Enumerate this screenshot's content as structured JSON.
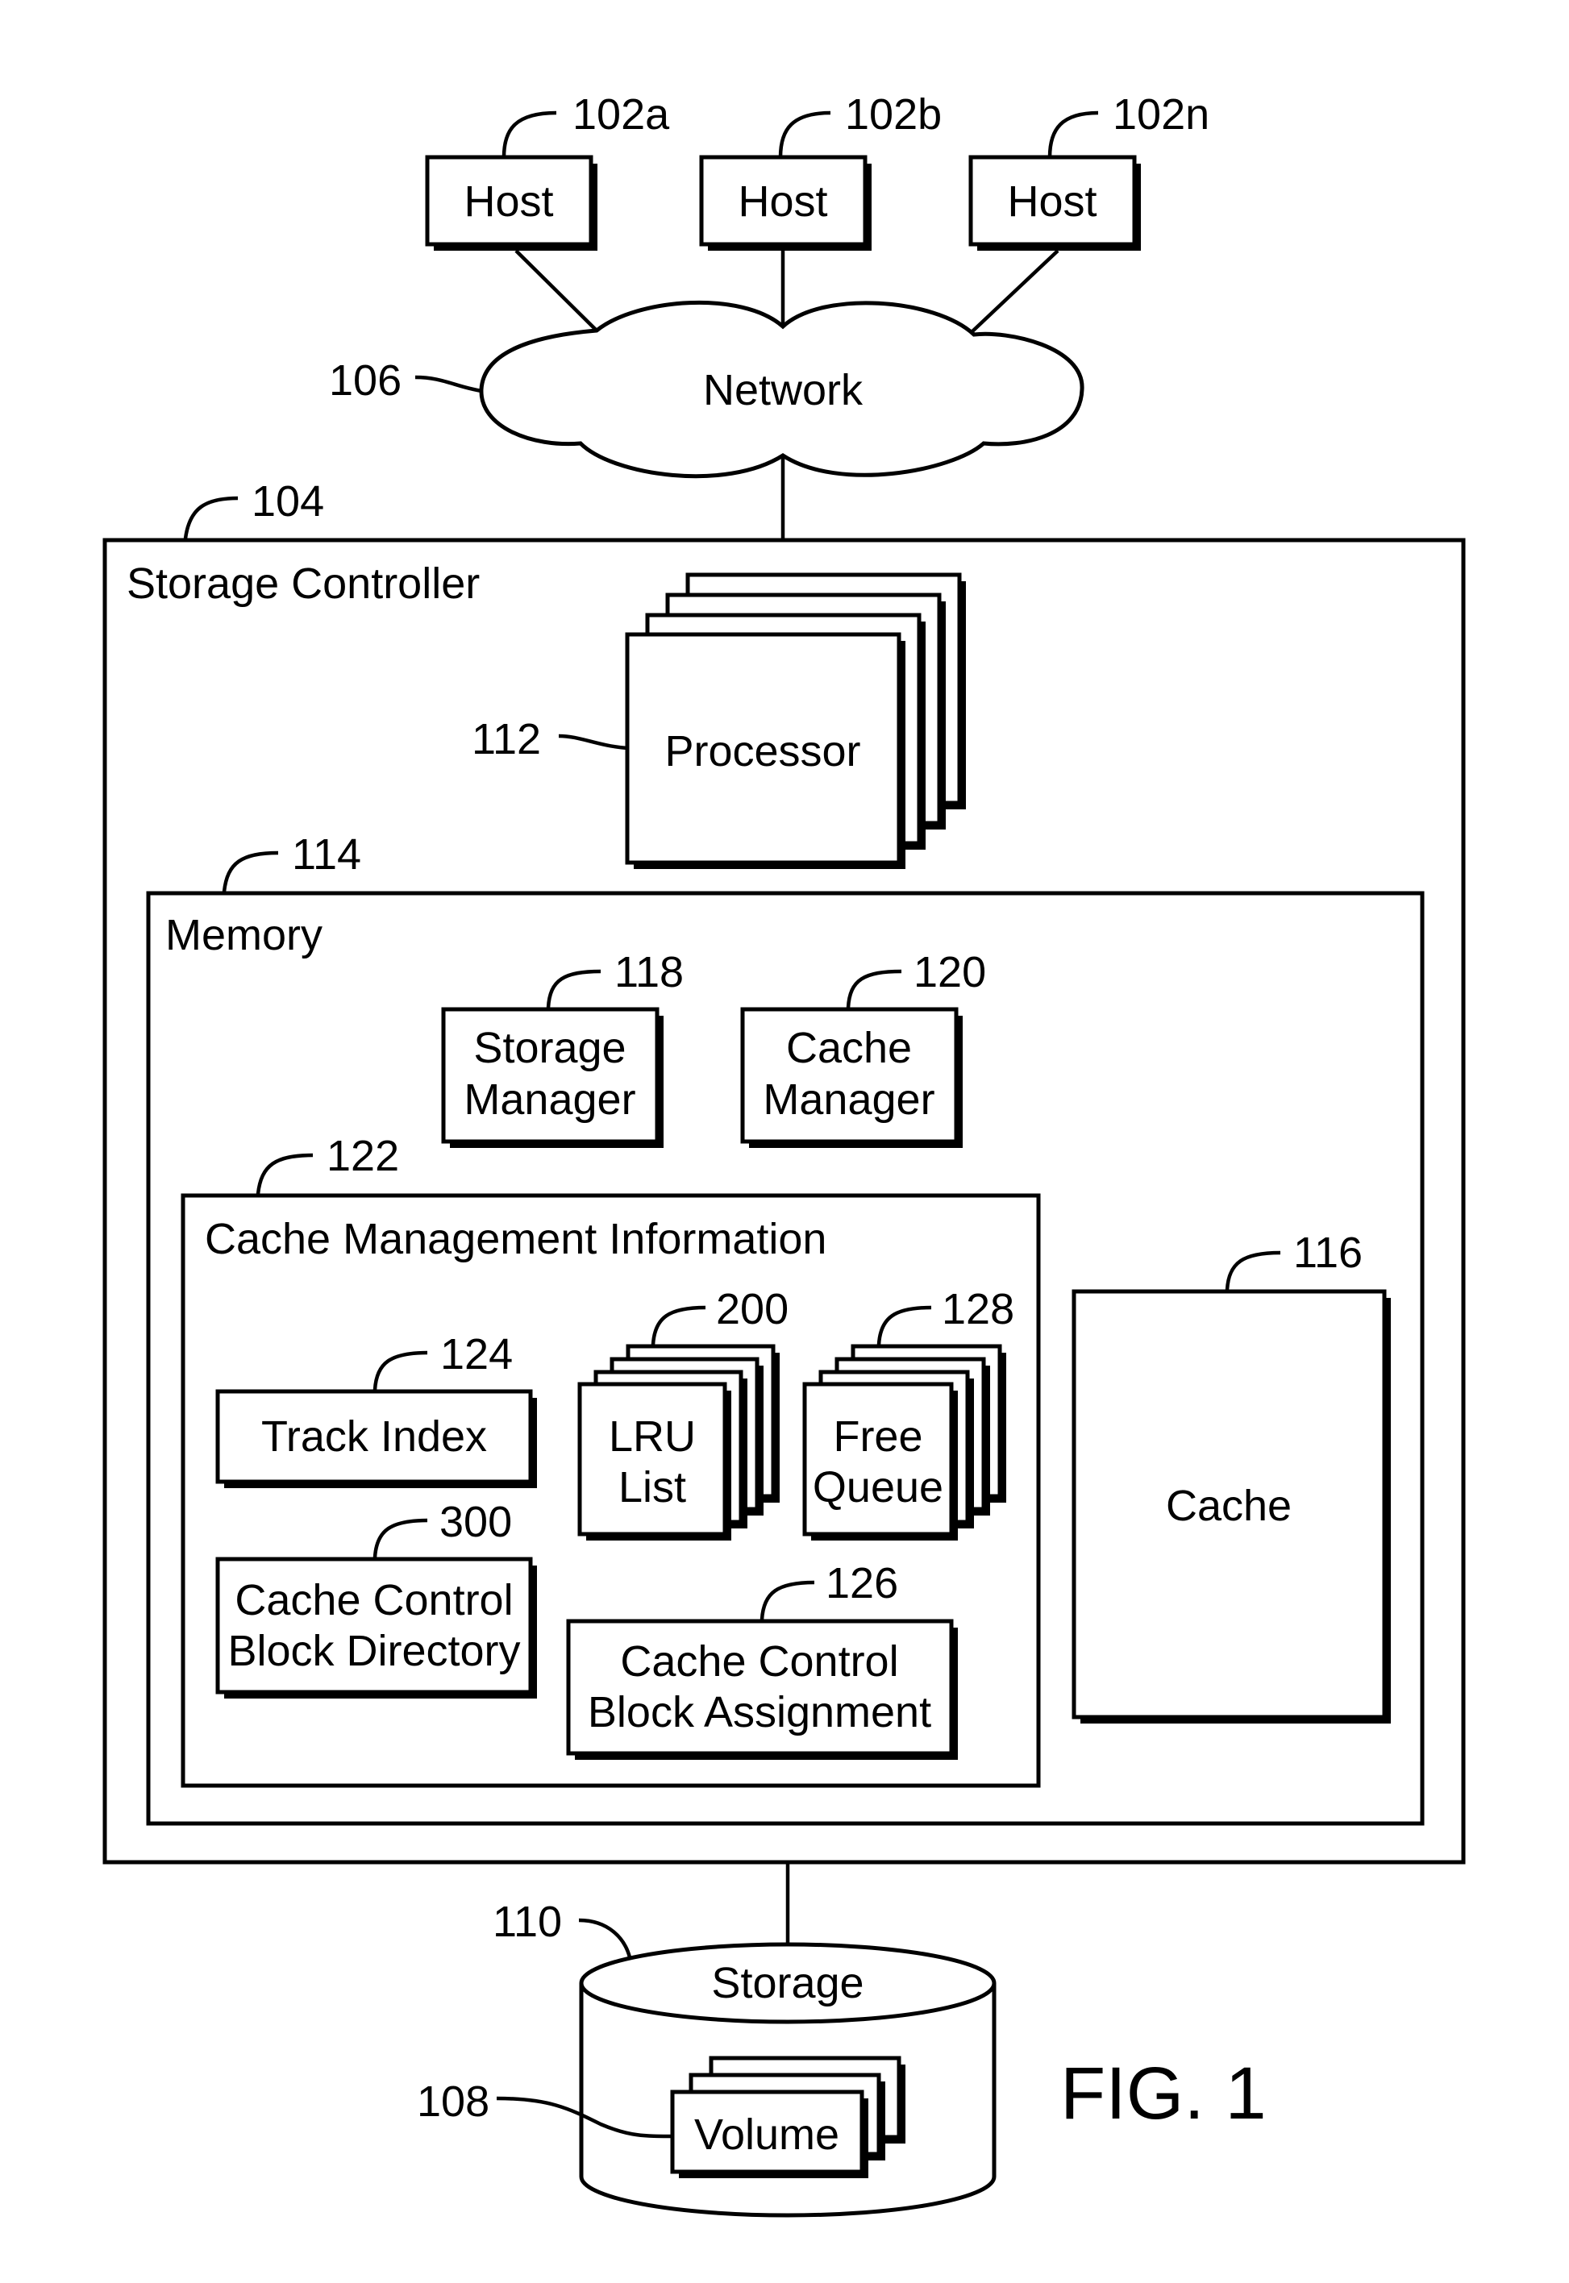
{
  "figure": {
    "caption": "FIG. 1",
    "hosts": [
      {
        "label": "Host",
        "ref": "102a"
      },
      {
        "label": "Host",
        "ref": "102b"
      },
      {
        "label": "Host",
        "ref": "102n"
      }
    ],
    "network": {
      "label": "Network",
      "ref": "106"
    },
    "storage_controller": {
      "label": "Storage Controller",
      "ref": "104"
    },
    "processor": {
      "label": "Processor",
      "ref": "112"
    },
    "memory": {
      "label": "Memory",
      "ref": "114"
    },
    "storage_manager": {
      "line1": "Storage",
      "line2": "Manager",
      "ref": "118"
    },
    "cache_manager": {
      "line1": "Cache",
      "line2": "Manager",
      "ref": "120"
    },
    "cache_management_information": {
      "label": "Cache Management Information",
      "ref": "122"
    },
    "track_index": {
      "label": "Track Index",
      "ref": "124"
    },
    "lru_list": {
      "line1": "LRU",
      "line2": "List",
      "ref": "200"
    },
    "free_queue": {
      "line1": "Free",
      "line2": "Queue",
      "ref": "128"
    },
    "ccb_directory": {
      "line1": "Cache Control",
      "line2": "Block Directory",
      "ref": "300"
    },
    "ccb_assignment": {
      "line1": "Cache Control",
      "line2": "Block Assignment",
      "ref": "126"
    },
    "cache": {
      "label": "Cache",
      "ref": "116"
    },
    "storage": {
      "label": "Storage",
      "ref": "110"
    },
    "volume": {
      "label": "Volume",
      "ref": "108"
    }
  }
}
